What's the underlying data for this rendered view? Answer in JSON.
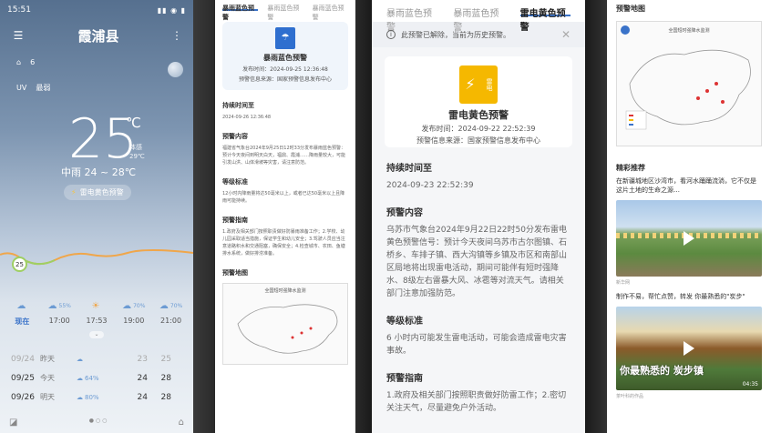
{
  "panel1": {
    "status_time": "15:51",
    "city": "霞浦县",
    "aqi_value": "6",
    "uv_label": "UV",
    "uv_value": "最弱",
    "temperature": "25",
    "deg_symbol": "℃",
    "feels_label": "体感",
    "feels_value": "29℃",
    "condition": "中雨 24 ~ 28℃",
    "warning_pill": "雷电黄色预警",
    "current_badge": "25",
    "hourly": [
      {
        "time": "现在",
        "precip": ""
      },
      {
        "time": "17:00",
        "precip": "55%"
      },
      {
        "time": "17:53",
        "precip": ""
      },
      {
        "time": "19:00",
        "precip": "70%"
      },
      {
        "time": "21:00",
        "precip": "70%"
      }
    ],
    "daily": [
      {
        "date": "09/24",
        "label": "昨天",
        "precip": "",
        "lo": "23",
        "hi": "25"
      },
      {
        "date": "09/25",
        "label": "今天",
        "precip": "64%",
        "lo": "24",
        "hi": "28"
      },
      {
        "date": "09/26",
        "label": "明天",
        "precip": "80%",
        "lo": "24",
        "hi": "28"
      }
    ]
  },
  "panel2": {
    "tabs": [
      "暴雨蓝色预警",
      "暴雨蓝色预警",
      "暴雨蓝色预警"
    ],
    "card_title": "暴雨蓝色预警",
    "card_time": "发布时间：2024-09-25 12:36:48",
    "card_source": "预警信息来源：国家预警信息发布中心",
    "dur_title": "持续时间至",
    "dur_value": "2024-09-26 12:36:48",
    "content_title": "预警内容",
    "content_text": "福建省气象台2024年9月25日12时33分发布暴雨蓝色预警：预计今天夜间到明天白天，福鼎、霞浦……降雨量较大，可能引发山洪、山体滑坡等灾害，请注意防范。",
    "level_title": "等级标准",
    "level_text": "12小时内降雨量将达50毫米以上，或者已达50毫米以上且降雨可能持续。",
    "guide_title": "预警指南",
    "guide_text": "1.政府及相关部门按照职责做好防暴雨准备工作；2.学校、幼儿园采取适当措施，保证学生和幼儿安全；3.驾驶人员应当注意道路积水和交通阻塞，确保安全；4.检查城市、农田、鱼塘排水系统，做好排涝准备。",
    "map_title": "预警地图",
    "map_caption": "全国短时强降水监测"
  },
  "panel3": {
    "tabs": [
      "暴雨蓝色预警",
      "暴雨蓝色预警",
      "雷电黄色预警"
    ],
    "notice": "此预警已解除，当前为历史预警。",
    "card_badge": "雷电",
    "card_title": "雷电黄色预警",
    "card_time": "发布时间：2024-09-22 22:52:39",
    "card_source": "预警信息来源：国家预警信息发布中心",
    "dur_title": "持续时间至",
    "dur_value": "2024-09-23 22:52:39",
    "content_title": "预警内容",
    "content_text": "乌苏市气象台2024年9月22日22时50分发布雷电黄色预警信号：预计今天夜间乌苏市古尔图镇、石桥乡、车排子镇、西大沟镇等乡镇及市区和南部山区局地将出现雷电活动，期间可能伴有短时强降水、8级左右雷暴大风、冰雹等对流天气。请相关部门注意加强防范。",
    "level_title": "等级标准",
    "level_text": "6 小时内可能发生雷电活动，可能会造成雷电灾害事故。",
    "guide_title": "预警指南",
    "guide_text": "1.政府及相关部门按照职责做好防雷工作；2.密切关注天气，尽量避免户外活动。"
  },
  "panel4": {
    "map_title": "预警地图",
    "map_caption": "全国短时强降水监测",
    "rec_title": "精彩推荐",
    "article1": "在新疆城地区沙湾市，看河水踊踊流淌，它不仅是这片土地的生命之源…",
    "article1_src": "新华网",
    "article2": "制作不易，帮忙点赞，转发 你最熟悉的\"炭步\"",
    "video2_overlay": "你最熟悉的 炭步镇",
    "video2_dur": "04:35",
    "article2_src": "茶叶科的作品"
  }
}
